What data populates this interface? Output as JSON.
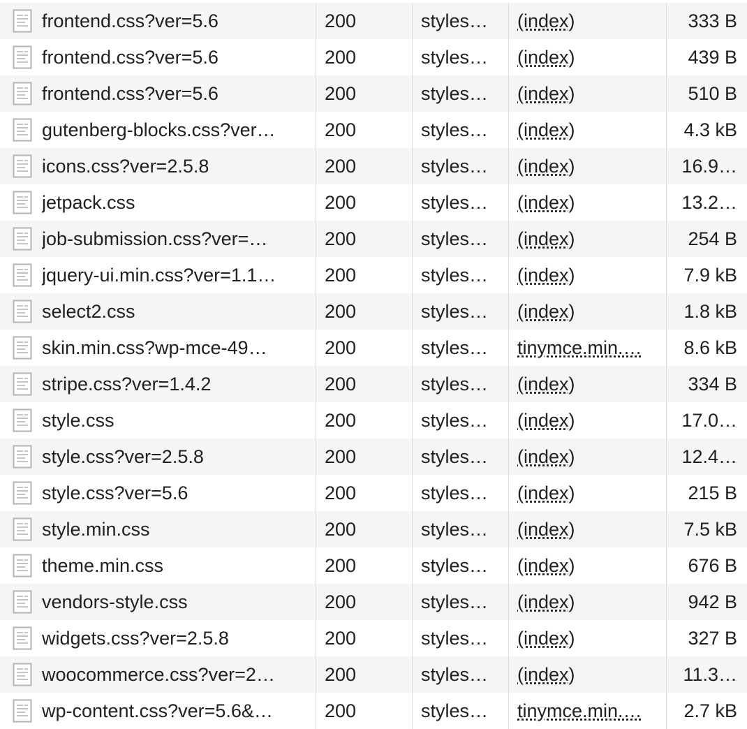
{
  "network_panel": {
    "rows": [
      {
        "name": "frontend.css?ver=5.6",
        "status": "200",
        "type": "styles…",
        "initiator": "(index)",
        "size": "333 B"
      },
      {
        "name": "frontend.css?ver=5.6",
        "status": "200",
        "type": "styles…",
        "initiator": "(index)",
        "size": "439 B"
      },
      {
        "name": "frontend.css?ver=5.6",
        "status": "200",
        "type": "styles…",
        "initiator": "(index)",
        "size": "510 B"
      },
      {
        "name": "gutenberg-blocks.css?ver…",
        "status": "200",
        "type": "styles…",
        "initiator": "(index)",
        "size": "4.3 kB"
      },
      {
        "name": "icons.css?ver=2.5.8",
        "status": "200",
        "type": "styles…",
        "initiator": "(index)",
        "size": "16.9…"
      },
      {
        "name": "jetpack.css",
        "status": "200",
        "type": "styles…",
        "initiator": "(index)",
        "size": "13.2…"
      },
      {
        "name": "job-submission.css?ver=…",
        "status": "200",
        "type": "styles…",
        "initiator": "(index)",
        "size": "254 B"
      },
      {
        "name": "jquery-ui.min.css?ver=1.1…",
        "status": "200",
        "type": "styles…",
        "initiator": "(index)",
        "size": "7.9 kB"
      },
      {
        "name": "select2.css",
        "status": "200",
        "type": "styles…",
        "initiator": "(index)",
        "size": "1.8 kB"
      },
      {
        "name": "skin.min.css?wp-mce-49…",
        "status": "200",
        "type": "styles…",
        "initiator": "tinymce.min.…",
        "size": "8.6 kB"
      },
      {
        "name": "stripe.css?ver=1.4.2",
        "status": "200",
        "type": "styles…",
        "initiator": "(index)",
        "size": "334 B"
      },
      {
        "name": "style.css",
        "status": "200",
        "type": "styles…",
        "initiator": "(index)",
        "size": "17.0…"
      },
      {
        "name": "style.css?ver=2.5.8",
        "status": "200",
        "type": "styles…",
        "initiator": "(index)",
        "size": "12.4…"
      },
      {
        "name": "style.css?ver=5.6",
        "status": "200",
        "type": "styles…",
        "initiator": "(index)",
        "size": "215 B"
      },
      {
        "name": "style.min.css",
        "status": "200",
        "type": "styles…",
        "initiator": "(index)",
        "size": "7.5 kB"
      },
      {
        "name": "theme.min.css",
        "status": "200",
        "type": "styles…",
        "initiator": "(index)",
        "size": "676 B"
      },
      {
        "name": "vendors-style.css",
        "status": "200",
        "type": "styles…",
        "initiator": "(index)",
        "size": "942 B"
      },
      {
        "name": "widgets.css?ver=2.5.8",
        "status": "200",
        "type": "styles…",
        "initiator": "(index)",
        "size": "327 B"
      },
      {
        "name": "woocommerce.css?ver=2…",
        "status": "200",
        "type": "styles…",
        "initiator": "(index)",
        "size": "11.3…"
      },
      {
        "name": "wp-content.css?ver=5.6&…",
        "status": "200",
        "type": "styles…",
        "initiator": "tinymce.min.…",
        "size": "2.7 kB"
      }
    ],
    "icons": {
      "row_icon": "document-icon"
    },
    "colors": {
      "row_stripe": "#f5f5f5",
      "row_plain": "#ffffff",
      "column_divider": "#dadce0",
      "text": "#202124"
    }
  }
}
